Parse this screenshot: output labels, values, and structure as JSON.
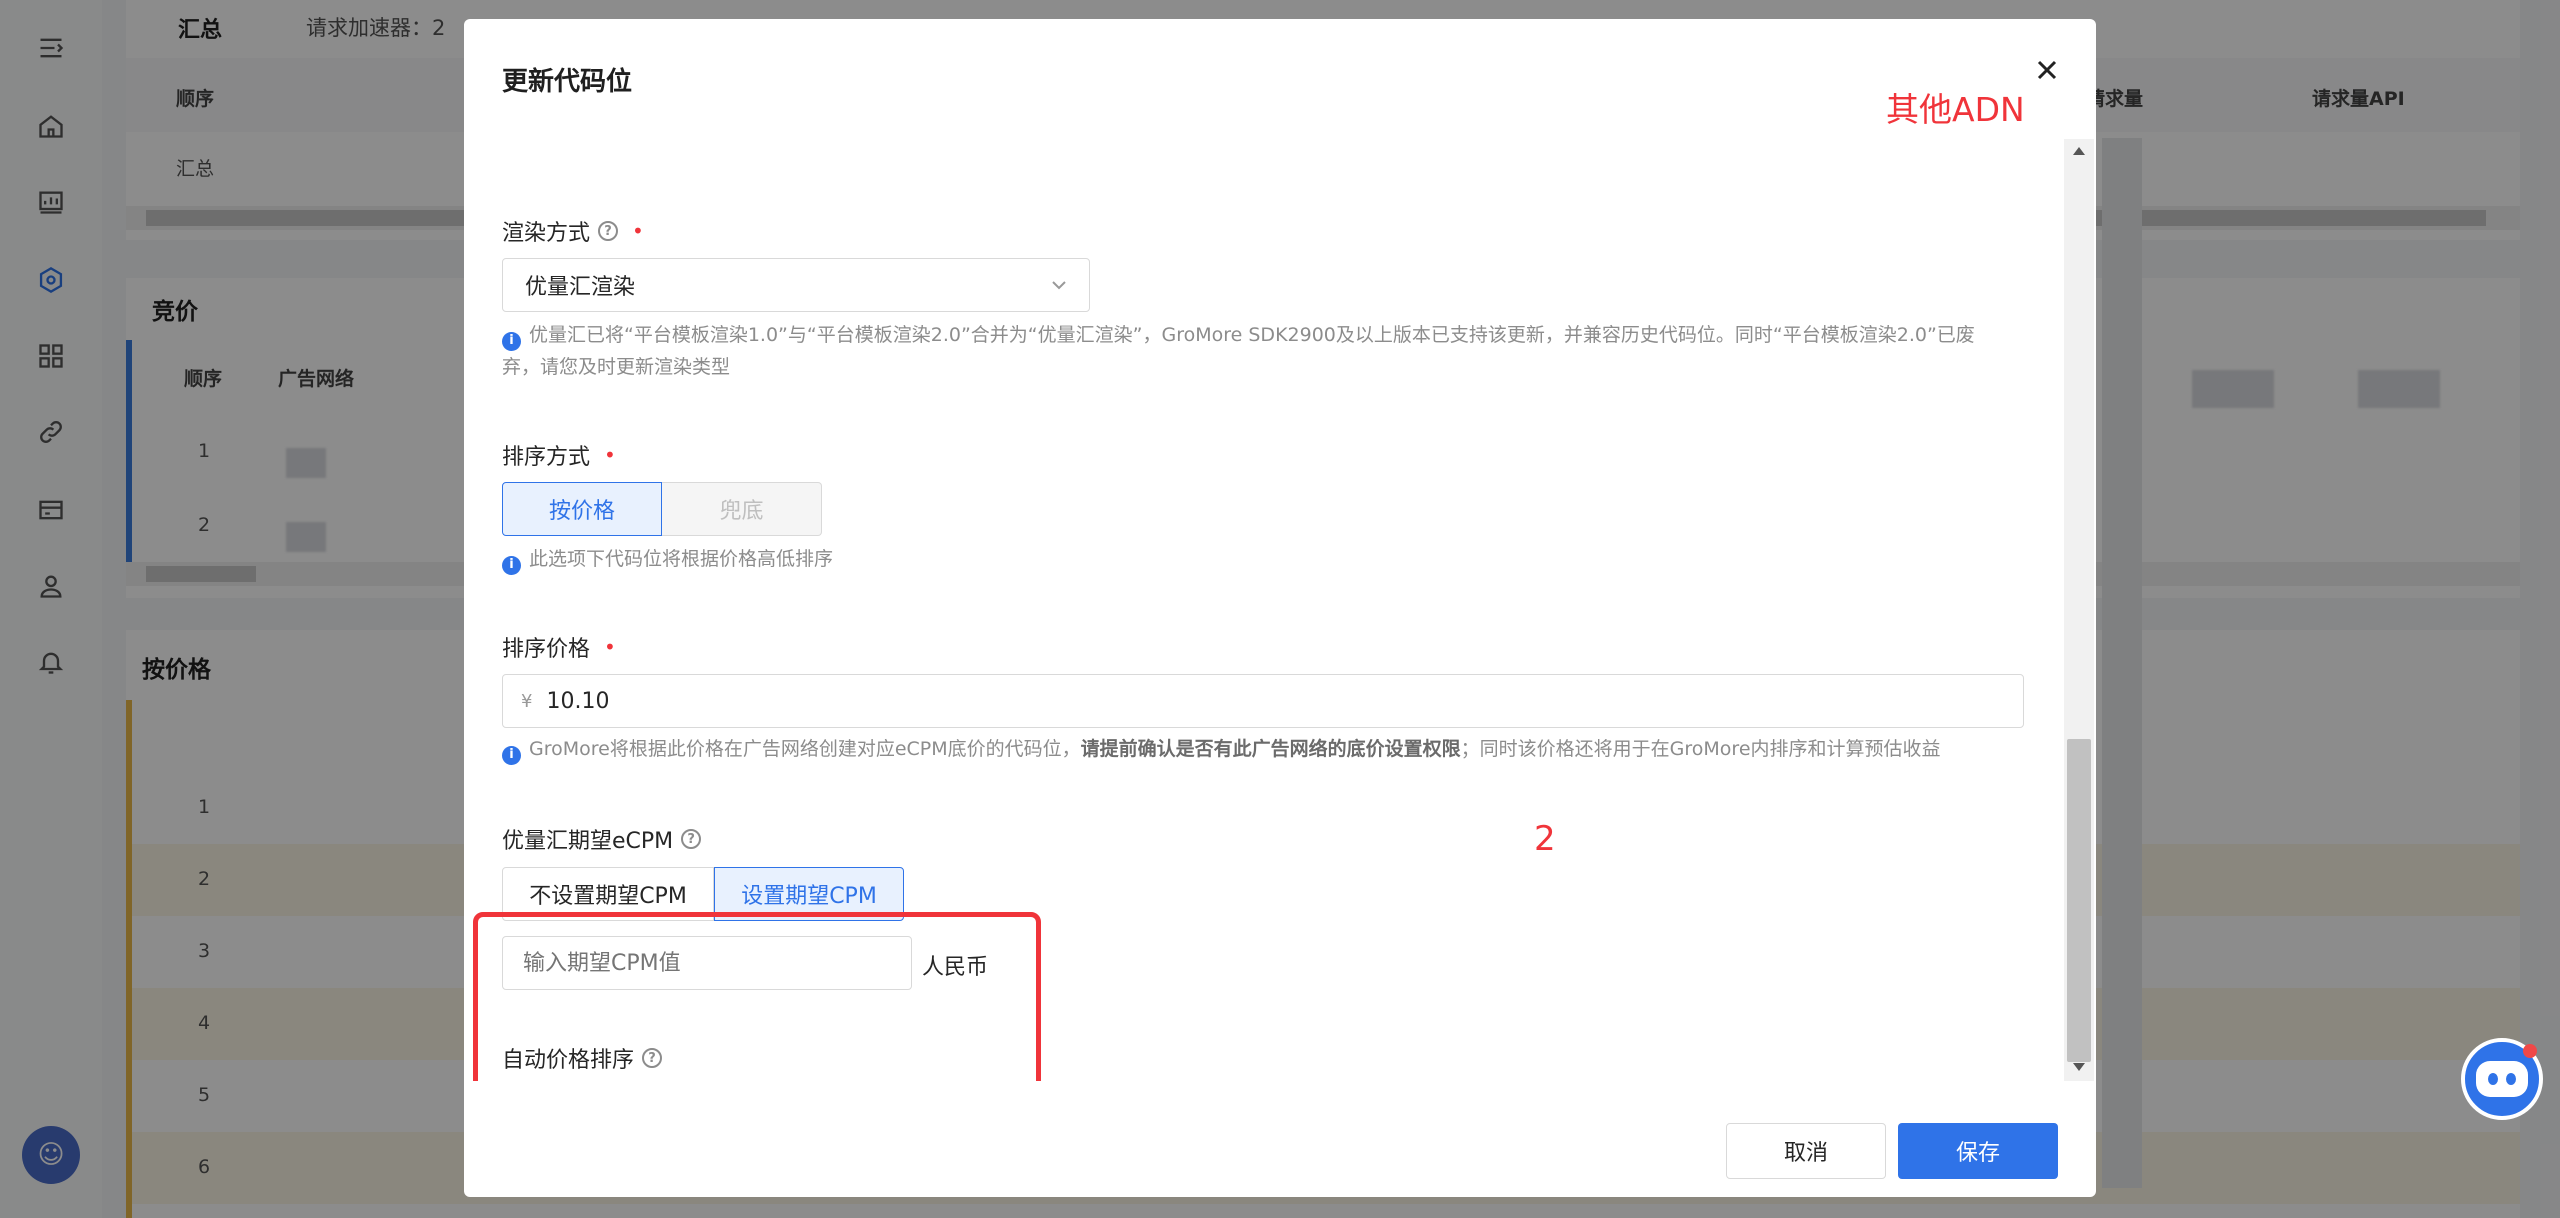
{
  "background": {
    "summary": {
      "title": "汇总",
      "accelerator_label": "请求加速器：2",
      "col_order": "顺序",
      "row_summary": "汇总",
      "col_request_count": "请求量",
      "col_request_api": "请求量API"
    },
    "bidding": {
      "title": "竞价",
      "col_order": "顺序",
      "col_ad_network": "广告网络",
      "rows": [
        "1",
        "2"
      ]
    },
    "by_price": {
      "title": "按价格",
      "rows": [
        "1",
        "2",
        "3",
        "4",
        "5",
        "6"
      ]
    }
  },
  "modal": {
    "title": "更新代码位",
    "annotation_note": "其他ADN",
    "annotation_number": "2",
    "render_mode": {
      "label": "渲染方式",
      "value": "优量汇渲染",
      "hint": "优量汇已将“平台模板渲染1.0”与“平台模板渲染2.0”合并为“优量汇渲染”，GroMore SDK2900及以上版本已支持该更新，并兼容历史代码位。同时“平台模板渲染2.0”已废弃，请您及时更新渲染类型"
    },
    "sort_mode": {
      "label": "排序方式",
      "options": [
        "按价格",
        "兜底"
      ],
      "selected": "按价格",
      "hint": "此选项下代码位将根据价格高低排序"
    },
    "sort_price": {
      "label": "排序价格",
      "currency": "¥",
      "value": "10.10",
      "hint_pre": "GroMore将根据此价格在广告网络创建对应eCPM底价的代码位，",
      "hint_bold": "请提前确认是否有此广告网络的底价设置权限",
      "hint_post": "；同时该价格还将用于在GroMore内排序和计算预估收益"
    },
    "expected_ecpm": {
      "label": "优量汇期望eCPM",
      "options": [
        "不设置期望CPM",
        "设置期望CPM"
      ],
      "selected": "设置期望CPM",
      "placeholder": "输入期望CPM值",
      "unit": "人民币"
    },
    "auto_price_sort": {
      "label": "自动价格排序"
    },
    "buttons": {
      "cancel": "取消",
      "save": "保存"
    }
  },
  "colors": {
    "primary": "#2f73e8",
    "annotation_red": "#f0343a"
  }
}
